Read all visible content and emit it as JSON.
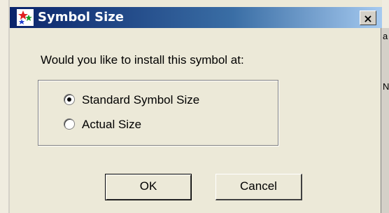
{
  "dialog": {
    "title": "Symbol Size",
    "close_label": "×",
    "prompt": "Would you like to install this symbol at:",
    "options": [
      {
        "label": "Standard Symbol Size",
        "checked": true
      },
      {
        "label": "Actual Size",
        "checked": false
      }
    ],
    "ok_label": "OK",
    "cancel_label": "Cancel"
  },
  "background_edge": {
    "char1": "a",
    "char2": "N"
  },
  "colors": {
    "titlebar_start": "#0a246a",
    "titlebar_end": "#a6caf0",
    "face": "#ece9d8"
  }
}
